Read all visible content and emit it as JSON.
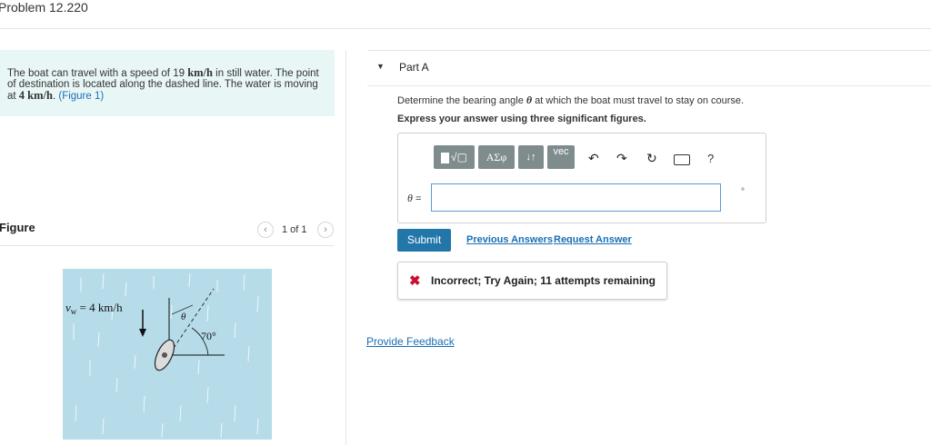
{
  "header": {
    "title": "Problem 12.220"
  },
  "problem": {
    "text_1": "The boat can travel with a speed of 19 ",
    "unit_1": "km/h",
    "text_2": " in still water. The point of destination is located along the dashed line. The water is moving at ",
    "value_2": "4 km/h",
    "text_3": ". ",
    "figure_link": "(Figure 1)"
  },
  "figure": {
    "label": "Figure",
    "pager": "1 of 1",
    "prev_icon": "chevron-left-icon",
    "next_icon": "chevron-right-icon",
    "water_label": "v",
    "water_label_sub": "w",
    "water_label_val": " = 4 km/h",
    "theta_label": "θ",
    "angle_label": "70°"
  },
  "part": {
    "title": "Part A",
    "caret_icon": "caret-down-icon",
    "question_prefix": "Determine the bearing angle ",
    "question_symbol": "θ",
    "question_suffix": " at which the boat must travel to stay on course.",
    "instruction": "Express your answer using three significant figures."
  },
  "toolbar": {
    "templates_label": "√▢",
    "greek_label": "ΑΣφ",
    "arrows_label": "↓↑",
    "vec_label": "vec",
    "undo_icon": "↶",
    "redo_icon": "↷",
    "reset_icon": "↻",
    "help_label": "?"
  },
  "answer": {
    "variable": "θ",
    "equals": " =",
    "value": "",
    "unit": "°"
  },
  "actions": {
    "submit": "Submit",
    "previous_answers": "Previous Answers",
    "request_answer": "Request Answer"
  },
  "feedback": {
    "status": "Incorrect; Try Again; 11 attempts remaining",
    "status_color": "#c8102e"
  },
  "footer": {
    "provide_feedback": "Provide Feedback"
  }
}
